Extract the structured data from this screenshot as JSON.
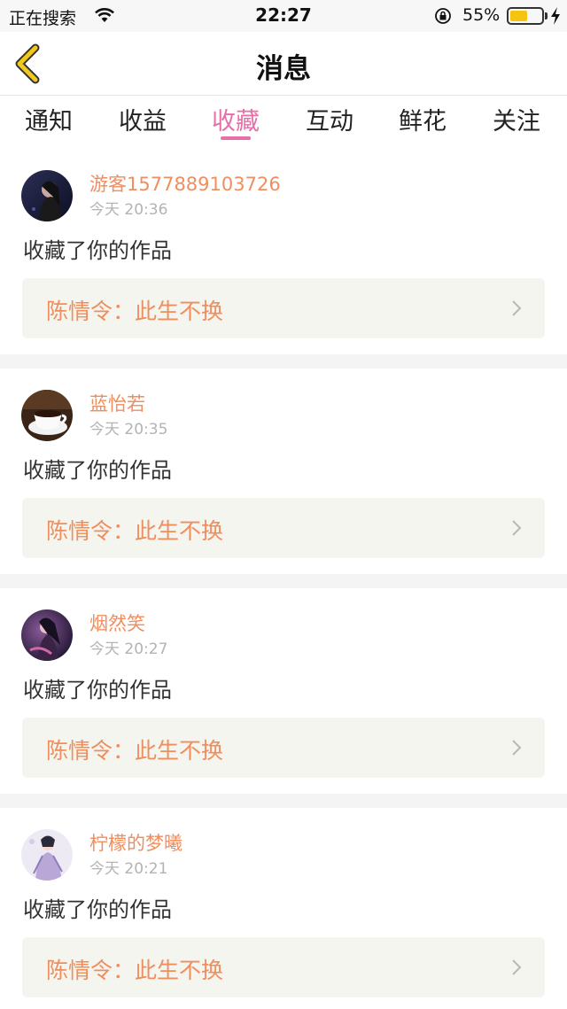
{
  "status_bar": {
    "carrier": "正在搜索",
    "time": "22:27",
    "battery_percent": "55%",
    "battery_level": 0.55,
    "icons": [
      "wifi-icon",
      "orientation-lock-icon",
      "battery-icon",
      "charging-bolt-icon"
    ]
  },
  "nav": {
    "title": "消息",
    "back_icon": "chevron-left-icon",
    "accent_color": "#f2c81a"
  },
  "tabs": [
    {
      "label": "通知",
      "active": false
    },
    {
      "label": "收益",
      "active": false
    },
    {
      "label": "收藏",
      "active": true
    },
    {
      "label": "互动",
      "active": false
    },
    {
      "label": "鲜花",
      "active": false
    },
    {
      "label": "关注",
      "active": false
    }
  ],
  "colors": {
    "active_tab": "#e86ea8",
    "username": "#ef8e5f",
    "card_bg": "#f5f5ef"
  },
  "items": [
    {
      "user": "游客1577889103726",
      "time": "今天 20:36",
      "action": "收藏了你的作品",
      "work": "陈情令：此生不换"
    },
    {
      "user": "蓝怡若",
      "time": "今天 20:35",
      "action": "收藏了你的作品",
      "work": "陈情令：此生不换"
    },
    {
      "user": "烟然笑",
      "time": "今天 20:27",
      "action": "收藏了你的作品",
      "work": "陈情令：此生不换"
    },
    {
      "user": "柠檬的梦曦",
      "time": "今天 20:21",
      "action": "收藏了你的作品",
      "work": "陈情令：此生不换"
    }
  ]
}
